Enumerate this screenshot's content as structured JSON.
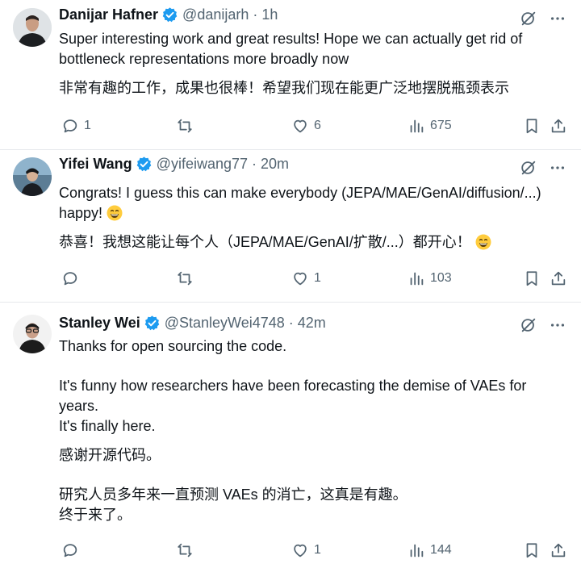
{
  "tweets": [
    {
      "name": "Danijar Hafner",
      "handle": "@danijarh",
      "time": "1h",
      "line1": "Super interesting work and great results! Hope we can actually get rid of",
      "line2": "bottleneck representations more broadly now",
      "zh": "非常有趣的工作，成果也很棒！希望我们现在能更广泛地摆脱瓶颈表示",
      "replies": "1",
      "likes": "6",
      "views": "675",
      "avatar_icon": "person-avatar-dark"
    },
    {
      "name": "Yifei Wang",
      "handle": "@yifeiwang77",
      "time": "20m",
      "line1": "Congrats! I guess this can make everybody (JEPA/MAE/GenAI/diffusion/...)",
      "line2": "happy!",
      "zh": "恭喜！我想这能让每个人（JEPA/MAE/GenAI/扩散/...）都开心！",
      "replies": "",
      "likes": "1",
      "views": "103",
      "avatar_icon": "person-avatar-outdoor"
    },
    {
      "name": "Stanley Wei",
      "handle": "@StanleyWei4748",
      "time": "42m",
      "line1": "Thanks for open sourcing the code.",
      "line2": "It's funny how researchers have been forecasting the demise of VAEs for",
      "line3": "years.",
      "line4": "It's finally here.",
      "zh1": "感谢开源代码。",
      "zh2": "研究人员多年来一直预测 VAEs 的消亡，这真是有趣。",
      "zh3": "终于来了。",
      "replies": "",
      "likes": "1",
      "views": "144",
      "avatar_icon": "person-avatar-glasses"
    }
  ],
  "dot": "·",
  "colors": {
    "verified": "#1d9bf0",
    "muted": "#536471",
    "text": "#0f1419"
  }
}
